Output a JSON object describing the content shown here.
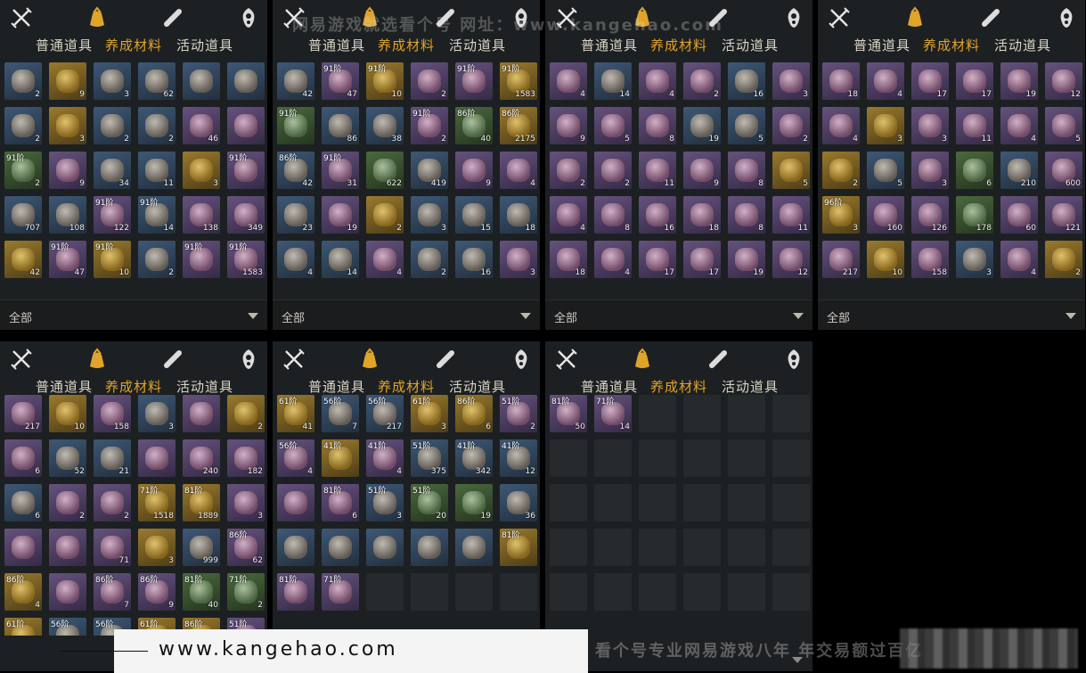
{
  "tabs_icons": [
    "swords-icon",
    "bag-icon",
    "scroll-icon",
    "gem-icon"
  ],
  "subtabs": [
    "普通道具",
    "养成材料",
    "活动道具"
  ],
  "active_subtab": 1,
  "filter": {
    "label": "全部"
  },
  "watermark_top": "网易游戏就选看个号 网址：www.kangehao.com",
  "footer": {
    "url": "www.kangehao.com",
    "slogan": "看个号专业网易游戏八年 年交易额过百亿"
  },
  "colors": {
    "active": "#e0a42b",
    "panel": "#1d2022"
  },
  "panels": [
    {
      "cells": [
        {
          "q": "b",
          "c": "2"
        },
        {
          "q": "g",
          "c": "9"
        },
        {
          "q": "b",
          "c": "3"
        },
        {
          "q": "b",
          "c": "62"
        },
        {
          "q": "b",
          "c": ""
        },
        {
          "q": "b",
          "c": ""
        },
        {
          "q": "b",
          "c": "2"
        },
        {
          "q": "g",
          "c": "3"
        },
        {
          "q": "b",
          "c": "2"
        },
        {
          "q": "b",
          "c": "2"
        },
        {
          "q": "p",
          "c": "46"
        },
        {
          "q": "p",
          "c": ""
        },
        {
          "q": "n",
          "t": "91阶",
          "c": "2"
        },
        {
          "q": "p",
          "c": "9"
        },
        {
          "q": "b",
          "c": "34"
        },
        {
          "q": "b",
          "c": "11"
        },
        {
          "q": "g",
          "c": "3"
        },
        {
          "q": "p",
          "t": "91阶",
          "c": ""
        },
        {
          "q": "b",
          "c": "707"
        },
        {
          "q": "b",
          "c": "108"
        },
        {
          "q": "p",
          "t": "91阶",
          "c": "122"
        },
        {
          "q": "b",
          "t": "91阶",
          "c": "14"
        },
        {
          "q": "p",
          "c": "138"
        },
        {
          "q": "p",
          "c": "349"
        },
        {
          "q": "g",
          "c": "42"
        },
        {
          "q": "p",
          "t": "91阶",
          "c": "47"
        },
        {
          "q": "g",
          "t": "91阶",
          "c": "10"
        },
        {
          "q": "b",
          "c": "2"
        },
        {
          "q": "p",
          "t": "91阶",
          "c": ""
        },
        {
          "q": "p",
          "t": "91阶",
          "c": "1583"
        }
      ]
    },
    {
      "cells": [
        {
          "q": "b",
          "c": "42"
        },
        {
          "q": "p",
          "t": "91阶",
          "c": "47"
        },
        {
          "q": "g",
          "t": "91阶",
          "c": "10"
        },
        {
          "q": "p",
          "c": "2"
        },
        {
          "q": "p",
          "t": "91阶",
          "c": ""
        },
        {
          "q": "g",
          "t": "91阶",
          "c": "1583"
        },
        {
          "q": "n",
          "t": "91阶",
          "c": ""
        },
        {
          "q": "b",
          "c": "86"
        },
        {
          "q": "b",
          "c": "38"
        },
        {
          "q": "p",
          "t": "91阶",
          "c": "2"
        },
        {
          "q": "n",
          "t": "86阶",
          "c": "40"
        },
        {
          "q": "g",
          "t": "86阶",
          "c": "2175"
        },
        {
          "q": "b",
          "t": "86阶",
          "c": "42"
        },
        {
          "q": "p",
          "t": "91阶",
          "c": "31"
        },
        {
          "q": "n",
          "c": "622"
        },
        {
          "q": "b",
          "c": "419"
        },
        {
          "q": "p",
          "c": "9"
        },
        {
          "q": "p",
          "c": "4"
        },
        {
          "q": "b",
          "c": "23"
        },
        {
          "q": "p",
          "c": "19"
        },
        {
          "q": "g",
          "c": "2"
        },
        {
          "q": "b",
          "c": "3"
        },
        {
          "q": "b",
          "c": "15"
        },
        {
          "q": "b",
          "c": "18"
        },
        {
          "q": "b",
          "c": "4"
        },
        {
          "q": "b",
          "c": "14"
        },
        {
          "q": "p",
          "c": "4"
        },
        {
          "q": "b",
          "c": "2"
        },
        {
          "q": "b",
          "c": "16"
        },
        {
          "q": "p",
          "c": "3"
        }
      ]
    },
    {
      "cells": [
        {
          "q": "p",
          "c": "4"
        },
        {
          "q": "b",
          "c": "14"
        },
        {
          "q": "p",
          "c": "4"
        },
        {
          "q": "p",
          "c": "2"
        },
        {
          "q": "b",
          "c": "16"
        },
        {
          "q": "p",
          "c": "3"
        },
        {
          "q": "p",
          "c": "9"
        },
        {
          "q": "p",
          "c": "5"
        },
        {
          "q": "p",
          "c": "8"
        },
        {
          "q": "b",
          "c": "19"
        },
        {
          "q": "b",
          "c": "5"
        },
        {
          "q": "p",
          "c": "2"
        },
        {
          "q": "p",
          "c": "2"
        },
        {
          "q": "p",
          "c": "2"
        },
        {
          "q": "p",
          "c": "11"
        },
        {
          "q": "p",
          "c": "9"
        },
        {
          "q": "p",
          "c": "8"
        },
        {
          "q": "g",
          "c": "5"
        },
        {
          "q": "p",
          "c": "4"
        },
        {
          "q": "p",
          "c": "8"
        },
        {
          "q": "p",
          "c": "16"
        },
        {
          "q": "p",
          "c": "18"
        },
        {
          "q": "p",
          "c": "8"
        },
        {
          "q": "p",
          "c": "11"
        },
        {
          "q": "p",
          "c": "18"
        },
        {
          "q": "p",
          "c": "4"
        },
        {
          "q": "p",
          "c": "17"
        },
        {
          "q": "p",
          "c": "17"
        },
        {
          "q": "p",
          "c": "19"
        },
        {
          "q": "p",
          "c": "12"
        }
      ]
    },
    {
      "cells": [
        {
          "q": "p",
          "c": "18"
        },
        {
          "q": "p",
          "c": "4"
        },
        {
          "q": "p",
          "c": "17"
        },
        {
          "q": "p",
          "c": "17"
        },
        {
          "q": "p",
          "c": "19"
        },
        {
          "q": "p",
          "c": "12"
        },
        {
          "q": "p",
          "c": "4"
        },
        {
          "q": "g",
          "c": "3"
        },
        {
          "q": "p",
          "c": "3"
        },
        {
          "q": "p",
          "c": "11"
        },
        {
          "q": "p",
          "c": "4"
        },
        {
          "q": "p",
          "c": "5"
        },
        {
          "q": "g",
          "c": "2"
        },
        {
          "q": "b",
          "c": "5"
        },
        {
          "q": "p",
          "c": "3"
        },
        {
          "q": "n",
          "c": "6"
        },
        {
          "q": "b",
          "c": "210"
        },
        {
          "q": "p",
          "c": "600"
        },
        {
          "q": "g",
          "t": "96阶",
          "c": "3"
        },
        {
          "q": "p",
          "c": "160"
        },
        {
          "q": "p",
          "c": "126"
        },
        {
          "q": "n",
          "c": "178"
        },
        {
          "q": "p",
          "c": "60"
        },
        {
          "q": "p",
          "c": "121"
        },
        {
          "q": "p",
          "c": "217"
        },
        {
          "q": "g",
          "c": "10"
        },
        {
          "q": "p",
          "c": "158"
        },
        {
          "q": "b",
          "c": "3"
        },
        {
          "q": "p",
          "c": "4"
        },
        {
          "q": "g",
          "c": "2"
        }
      ]
    },
    {
      "cells": [
        {
          "q": "p",
          "c": "217"
        },
        {
          "q": "g",
          "c": "10"
        },
        {
          "q": "p",
          "c": "158"
        },
        {
          "q": "b",
          "c": "3"
        },
        {
          "q": "p",
          "c": ""
        },
        {
          "q": "g",
          "c": "2"
        },
        {
          "q": "p",
          "c": "6"
        },
        {
          "q": "b",
          "c": "52"
        },
        {
          "q": "b",
          "c": "21"
        },
        {
          "q": "p",
          "c": ""
        },
        {
          "q": "p",
          "c": "240"
        },
        {
          "q": "p",
          "c": "182"
        },
        {
          "q": "b",
          "c": "6"
        },
        {
          "q": "p",
          "c": "2"
        },
        {
          "q": "p",
          "c": "2"
        },
        {
          "q": "g",
          "t": "71阶",
          "c": "1518"
        },
        {
          "q": "g",
          "t": "81阶",
          "c": "1889"
        },
        {
          "q": "p",
          "c": "3"
        },
        {
          "q": "p",
          "c": ""
        },
        {
          "q": "p",
          "c": ""
        },
        {
          "q": "p",
          "c": "71"
        },
        {
          "q": "g",
          "c": "3"
        },
        {
          "q": "b",
          "c": "999"
        },
        {
          "q": "p",
          "t": "86阶",
          "c": "62"
        },
        {
          "q": "g",
          "t": "86阶",
          "c": "4"
        },
        {
          "q": "p",
          "c": ""
        },
        {
          "q": "p",
          "t": "86阶",
          "c": "7"
        },
        {
          "q": "p",
          "t": "86阶",
          "c": "9"
        },
        {
          "q": "n",
          "t": "81阶",
          "c": "40"
        },
        {
          "q": "n",
          "t": "71阶",
          "c": "2"
        },
        {
          "q": "g",
          "t": "61阶",
          "c": ""
        },
        {
          "q": "b",
          "t": "56阶",
          "c": ""
        },
        {
          "q": "b",
          "t": "56阶",
          "c": ""
        },
        {
          "q": "g",
          "t": "61阶",
          "c": ""
        },
        {
          "q": "g",
          "t": "86阶",
          "c": ""
        },
        {
          "q": "p",
          "t": "51阶",
          "c": ""
        }
      ]
    },
    {
      "cells": [
        {
          "q": "g",
          "t": "61阶",
          "c": "41"
        },
        {
          "q": "b",
          "t": "56阶",
          "c": "7"
        },
        {
          "q": "b",
          "t": "56阶",
          "c": "217"
        },
        {
          "q": "g",
          "t": "61阶",
          "c": "3"
        },
        {
          "q": "g",
          "t": "86阶",
          "c": "6"
        },
        {
          "q": "p",
          "t": "51阶",
          "c": "2"
        },
        {
          "q": "p",
          "t": "56阶",
          "c": "4"
        },
        {
          "q": "g",
          "t": "41阶",
          "c": ""
        },
        {
          "q": "p",
          "t": "41阶",
          "c": "4"
        },
        {
          "q": "b",
          "t": "51阶",
          "c": "375"
        },
        {
          "q": "b",
          "t": "41阶",
          "c": "342"
        },
        {
          "q": "b",
          "t": "41阶",
          "c": "12"
        },
        {
          "q": "p",
          "c": ""
        },
        {
          "q": "p",
          "t": "81阶",
          "c": "6"
        },
        {
          "q": "b",
          "t": "51阶",
          "c": "3"
        },
        {
          "q": "n",
          "t": "51阶",
          "c": "20"
        },
        {
          "q": "n",
          "c": "19"
        },
        {
          "q": "b",
          "c": "36"
        },
        {
          "q": "b",
          "c": ""
        },
        {
          "q": "b",
          "c": ""
        },
        {
          "q": "b",
          "c": ""
        },
        {
          "q": "b",
          "c": ""
        },
        {
          "q": "b",
          "c": ""
        },
        {
          "q": "g",
          "t": "81阶",
          "c": ""
        },
        {
          "q": "p",
          "t": "81阶",
          "c": ""
        },
        {
          "q": "p",
          "t": "71阶",
          "c": ""
        },
        {
          "q": "e",
          "c": ""
        },
        {
          "q": "e",
          "c": ""
        },
        {
          "q": "e",
          "c": ""
        },
        {
          "q": "e",
          "c": ""
        }
      ]
    },
    {
      "cells": [
        {
          "q": "p",
          "t": "81阶",
          "c": "50"
        },
        {
          "q": "p",
          "t": "71阶",
          "c": "14"
        },
        {
          "q": "e",
          "c": ""
        },
        {
          "q": "e",
          "c": ""
        },
        {
          "q": "e",
          "c": ""
        },
        {
          "q": "e",
          "c": ""
        },
        {
          "q": "e",
          "c": ""
        },
        {
          "q": "e",
          "c": ""
        },
        {
          "q": "e",
          "c": ""
        },
        {
          "q": "e",
          "c": ""
        },
        {
          "q": "e",
          "c": ""
        },
        {
          "q": "e",
          "c": ""
        },
        {
          "q": "e",
          "c": ""
        },
        {
          "q": "e",
          "c": ""
        },
        {
          "q": "e",
          "c": ""
        },
        {
          "q": "e",
          "c": ""
        },
        {
          "q": "e",
          "c": ""
        },
        {
          "q": "e",
          "c": ""
        },
        {
          "q": "e",
          "c": ""
        },
        {
          "q": "e",
          "c": ""
        },
        {
          "q": "e",
          "c": ""
        },
        {
          "q": "e",
          "c": ""
        },
        {
          "q": "e",
          "c": ""
        },
        {
          "q": "e",
          "c": ""
        },
        {
          "q": "e",
          "c": ""
        },
        {
          "q": "e",
          "c": ""
        },
        {
          "q": "e",
          "c": ""
        },
        {
          "q": "e",
          "c": ""
        },
        {
          "q": "e",
          "c": ""
        },
        {
          "q": "e",
          "c": ""
        }
      ]
    }
  ]
}
